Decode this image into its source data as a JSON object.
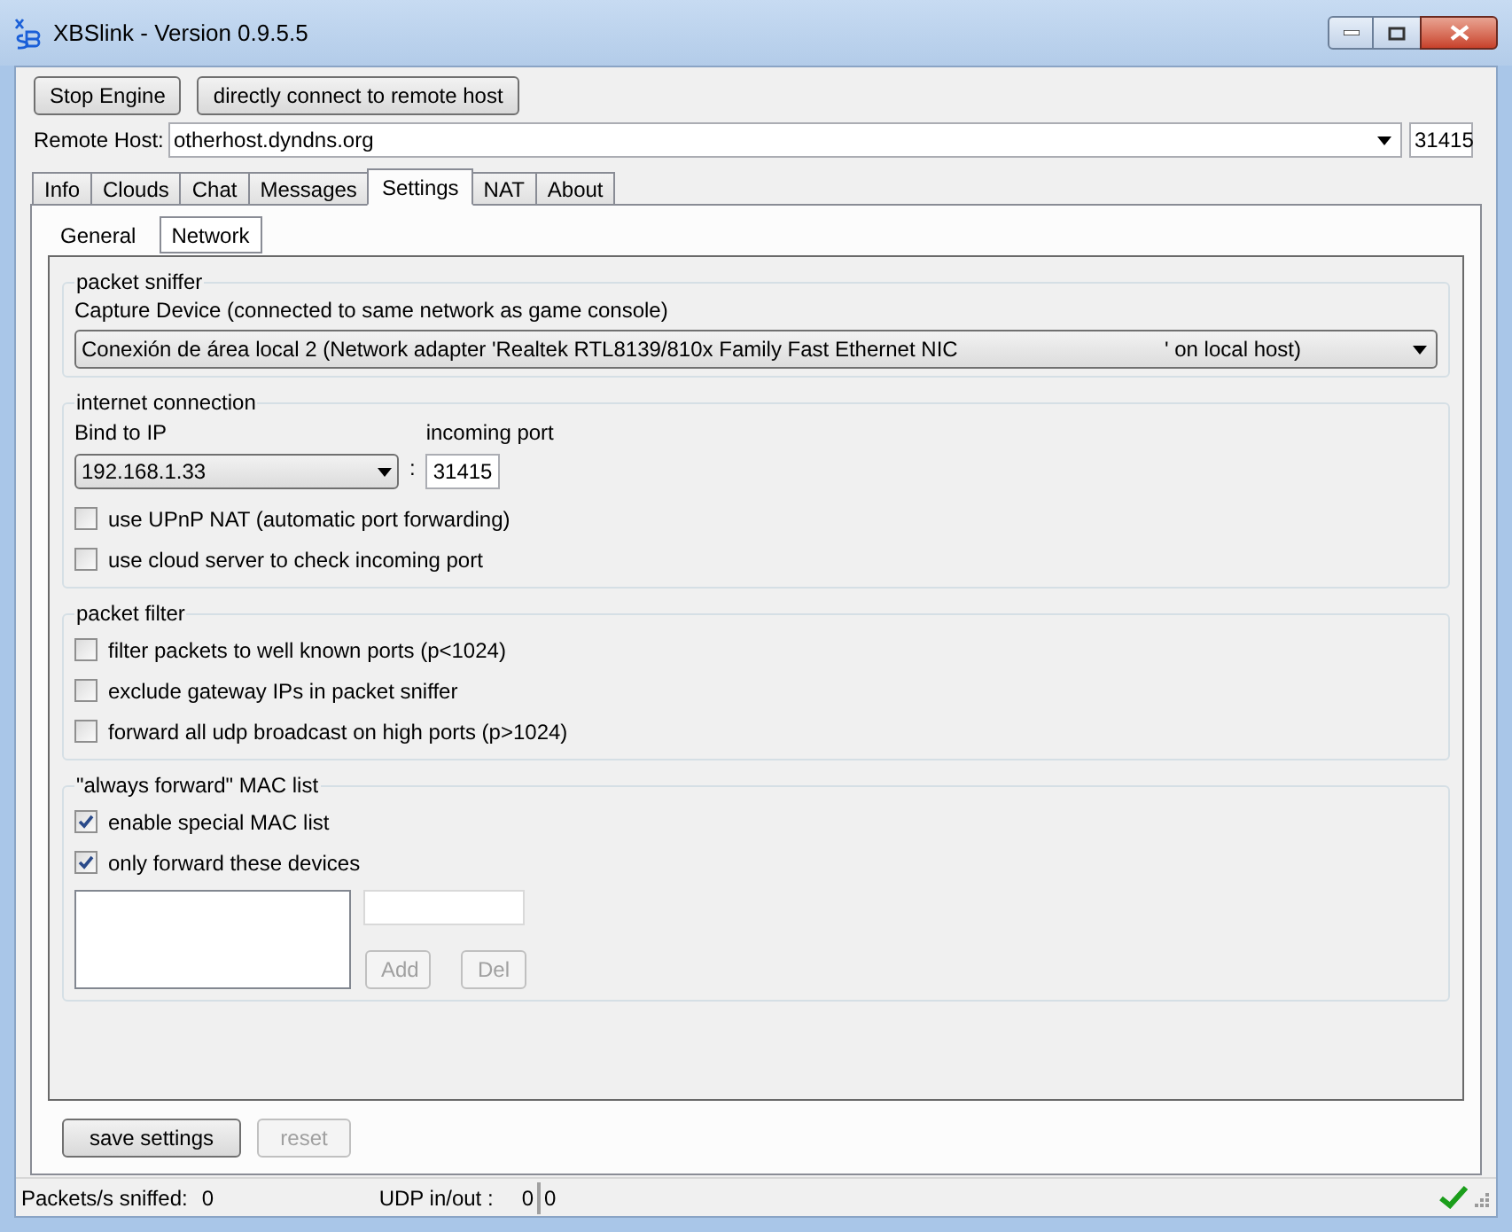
{
  "window": {
    "title": "XBSlink - Version 0.9.5.5"
  },
  "toolbar": {
    "buttons": [
      {
        "label": "Stop Engine",
        "disabled": false
      },
      {
        "label": "directly connect to remote host",
        "disabled": false
      }
    ]
  },
  "remote_host": {
    "label": "Remote Host:",
    "value": "otherhost.dyndns.org",
    "port": "31415"
  },
  "tabs": [
    {
      "label": "Info",
      "selected": false
    },
    {
      "label": "Clouds",
      "selected": false
    },
    {
      "label": "Chat",
      "selected": false
    },
    {
      "label": "Messages",
      "selected": false
    },
    {
      "label": "Settings",
      "selected": true
    },
    {
      "label": "NAT",
      "selected": false
    },
    {
      "label": "About",
      "selected": false
    }
  ],
  "subtabs": [
    {
      "label": "General",
      "selected": false
    },
    {
      "label": "Network",
      "selected": true
    }
  ],
  "packet_sniffer": {
    "title": "packet sniffer",
    "label": "Capture Device (connected to same network as game console)",
    "value": "Conexión de área local 2 (Network adapter 'Realtek RTL8139/810x Family Fast Ethernet NIC                                   ' on local host)"
  },
  "internet_connection": {
    "title": "internet connection",
    "bind_label": "Bind to IP",
    "bind_value": "192.168.1.33",
    "separator": ":",
    "port_label": "incoming port",
    "port_value": "31415",
    "options": [
      {
        "label": "use UPnP NAT (automatic port forwarding)",
        "checked": false
      },
      {
        "label": "use cloud server to check incoming port",
        "checked": false
      }
    ]
  },
  "packet_filter": {
    "title": "packet filter",
    "options": [
      {
        "label": "filter packets to well known ports (p<1024)",
        "checked": false
      },
      {
        "label": "exclude gateway IPs in packet sniffer",
        "checked": false
      },
      {
        "label": "forward all udp broadcast on high ports (p>1024)",
        "checked": false
      }
    ]
  },
  "mac_list": {
    "title": "\"always forward\" MAC list",
    "options": [
      {
        "label": "enable special MAC list",
        "checked": true
      },
      {
        "label": "only forward these devices",
        "checked": true
      }
    ],
    "buttons": [
      {
        "label": "Add",
        "disabled": true
      },
      {
        "label": "Del",
        "disabled": true
      }
    ]
  },
  "footer_buttons": [
    {
      "label": "save settings",
      "disabled": false
    },
    {
      "label": "reset",
      "disabled": true
    }
  ],
  "status_bar": {
    "packets_label": "Packets/s sniffed:",
    "packets_value": "0",
    "udp_label": "UDP in/out :",
    "udp_in": "0",
    "udp_out": "0"
  }
}
